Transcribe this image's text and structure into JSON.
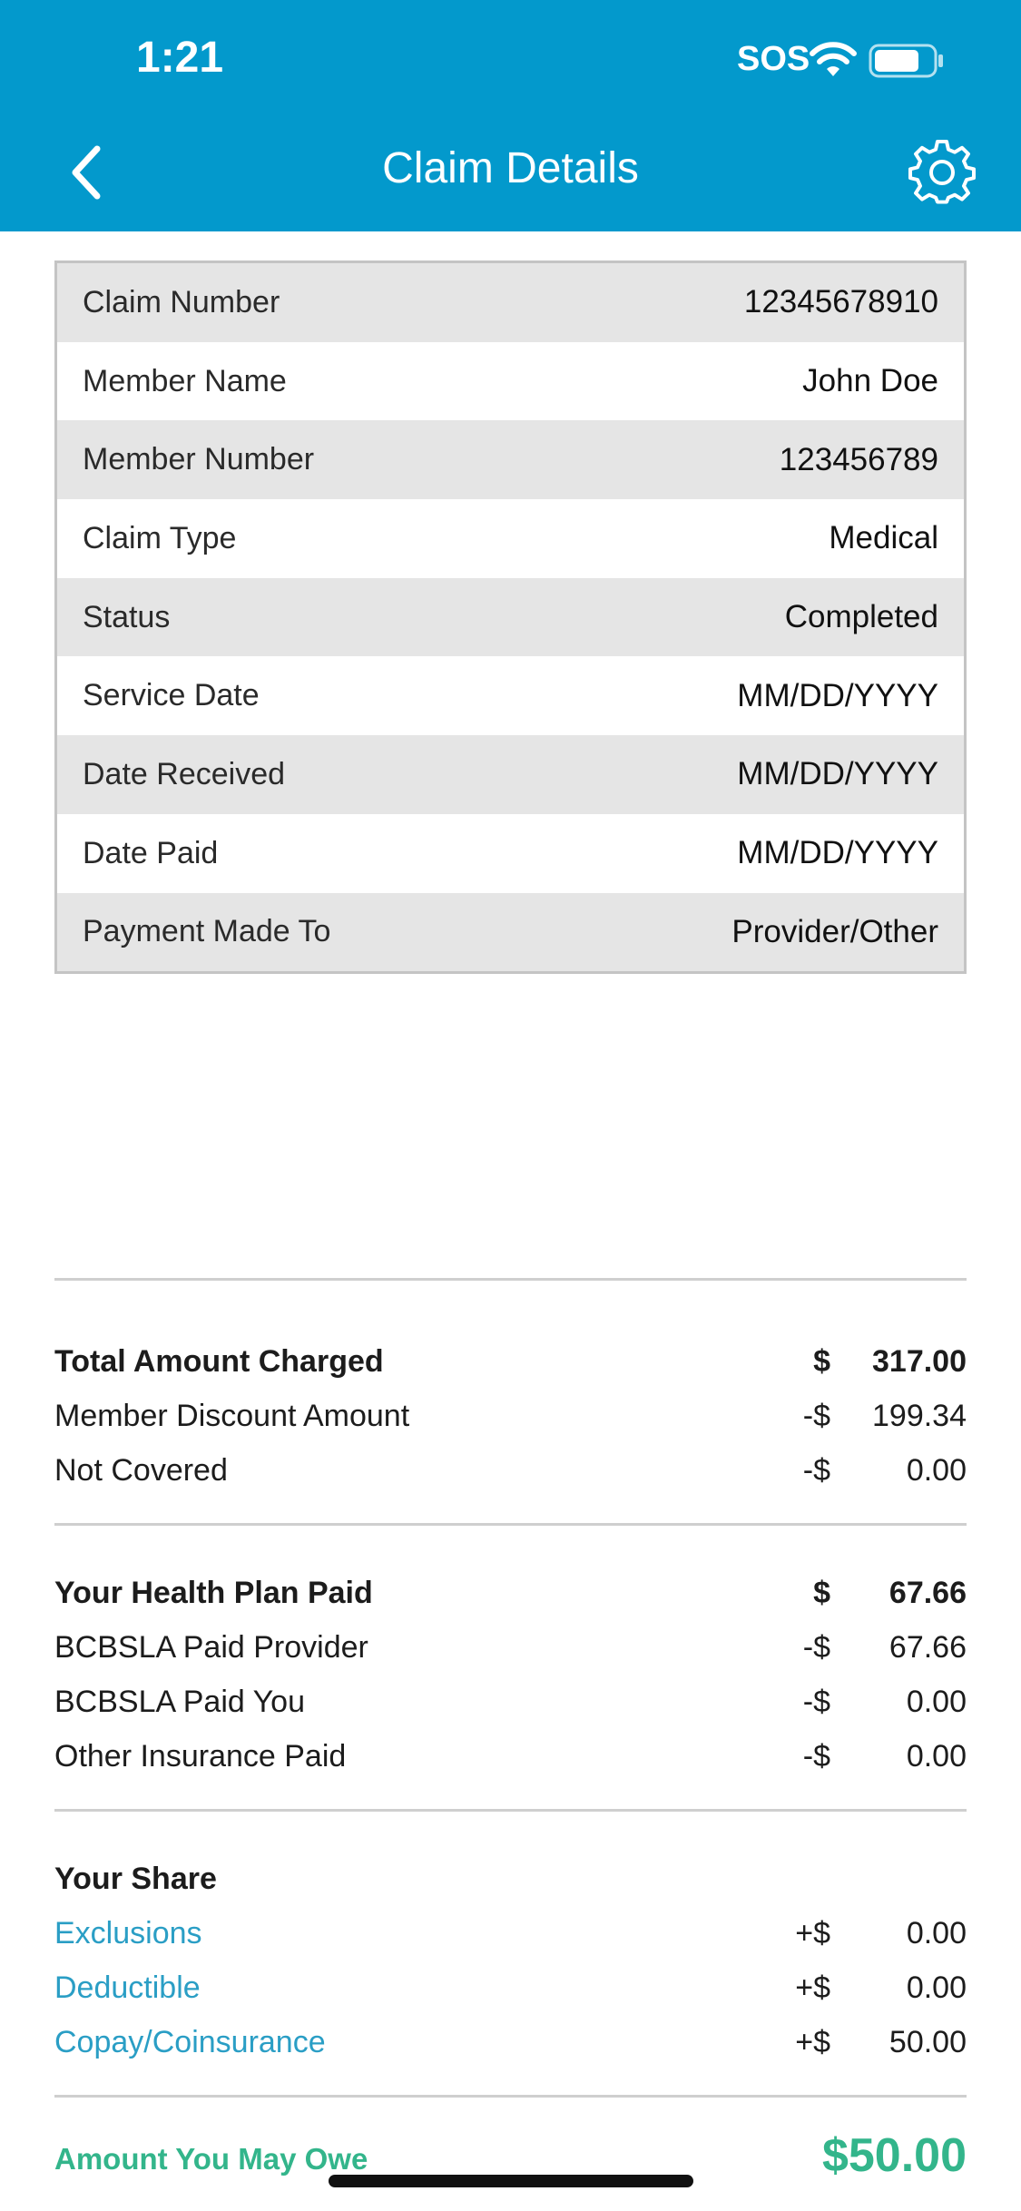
{
  "status_bar": {
    "time": "1:21",
    "sos": "SOS"
  },
  "nav": {
    "title": "Claim Details",
    "back_icon": "chevron-left-icon",
    "settings_icon": "gear-icon"
  },
  "details": [
    {
      "label": "Claim Number",
      "value": "12345678910"
    },
    {
      "label": "Member Name",
      "value": "John Doe"
    },
    {
      "label": "Member Number",
      "value": "123456789"
    },
    {
      "label": "Claim Type",
      "value": "Medical"
    },
    {
      "label": "Status",
      "value": "Completed"
    },
    {
      "label": "Service Date",
      "value": "MM/DD/YYYY"
    },
    {
      "label": "Date Received",
      "value": "MM/DD/YYYY"
    },
    {
      "label": "Date Paid",
      "value": "MM/DD/YYYY"
    },
    {
      "label": "Payment Made To",
      "value": "Provider/Other"
    }
  ],
  "charges": {
    "total": {
      "label": "Total Amount Charged",
      "sign": "$",
      "amount": "317.00"
    },
    "discount": {
      "label": "Member Discount Amount",
      "sign": "-$",
      "amount": "199.34"
    },
    "not_covered": {
      "label": "Not Covered",
      "sign": "-$",
      "amount": "0.00"
    }
  },
  "plan_paid": {
    "total": {
      "label": "Your Health Plan Paid",
      "sign": "$",
      "amount": "67.66"
    },
    "provider": {
      "label": "BCBSLA Paid Provider",
      "sign": "-$",
      "amount": "67.66"
    },
    "you": {
      "label": "BCBSLA Paid You",
      "sign": "-$",
      "amount": "0.00"
    },
    "other": {
      "label": "Other Insurance Paid",
      "sign": "-$",
      "amount": "0.00"
    }
  },
  "your_share": {
    "title": "Your Share",
    "exclusions": {
      "label": "Exclusions",
      "sign": "+$",
      "amount": "0.00"
    },
    "deductible": {
      "label": "Deductible",
      "sign": "+$",
      "amount": "0.00"
    },
    "copay": {
      "label": "Copay/Coinsurance",
      "sign": "+$",
      "amount": "50.00"
    }
  },
  "amount_owe": {
    "label": "Amount You May Owe",
    "value": "$50.00"
  },
  "colors": {
    "header": "#0399CC",
    "link": "#2a9ec5",
    "owe": "#33b58b"
  }
}
